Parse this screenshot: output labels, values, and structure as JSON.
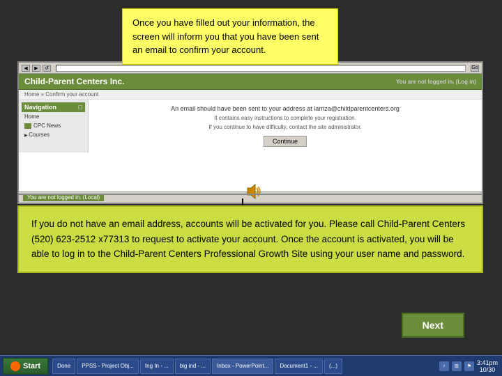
{
  "background": {
    "color": "#2c2c2c"
  },
  "top_info_box": {
    "text": "Once you have filled out your information, the screen will inform you that you have been sent an email to confirm your account."
  },
  "browser": {
    "org_name": "Child-Parent Centers Inc.",
    "logged_in_status_top": "You are not logged in. (Log in)",
    "breadcrumb": "Home » Confirm your account",
    "sidebar": {
      "header": "Navigation",
      "expand_icon": "□",
      "items": [
        {
          "label": "Home"
        },
        {
          "label": "CPC News",
          "has_icon": true
        },
        {
          "label": "Courses",
          "expandable": true
        }
      ]
    },
    "main_area": {
      "email_notice": "An email should have been sent to your address at larriza@childparentcenters.org",
      "instructions": "It contains easy instructions to complete your registration.",
      "difficulty": "If you continue to have difficulty, contact the site administrator.",
      "continue_button": "Continue"
    },
    "status_bar": {
      "logged_in_text": "You are not logged in. (Local)"
    }
  },
  "bottom_info_box": {
    "text": "If you do not have an email address, accounts will be activated for you.  Please call Child-Parent Centers (520) 623-2512 x77313  to request to activate your account.   Once the account is activated, you will be able to log in to the Child-Parent Centers Professional Growth Site using your user name and password."
  },
  "next_button": {
    "label": "Next"
  },
  "taskbar": {
    "start_label": "Start",
    "apps": [
      {
        "label": "Done"
      },
      {
        "label": "PPSS - Project Obj..."
      },
      {
        "label": "Ing In - ..."
      },
      {
        "label": "big ind - ..."
      },
      {
        "label": "Inbox - PowerPoint..."
      },
      {
        "label": "Document1 - ..."
      },
      {
        "label": "(...)"
      }
    ],
    "system": {
      "time": "3:41pm",
      "date": "10/30",
      "icons": [
        "vol",
        "net",
        "antivirus"
      ]
    }
  }
}
